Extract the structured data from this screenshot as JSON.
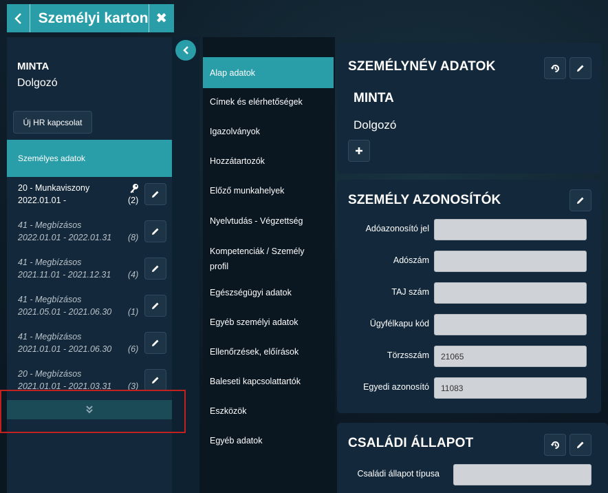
{
  "window": {
    "title": "Személyi karton",
    "back_icon": "chevron-left-icon",
    "close_icon": "close-icon"
  },
  "person": {
    "name": "MINTA",
    "role": "Dolgozó"
  },
  "left": {
    "new_hr_label": "Új HR kapcsolat",
    "personal_tab": "Személyes adatok",
    "relations": [
      {
        "title": "20 - Munkaviszony",
        "dates": "2022.01.01 -",
        "count": "(2)",
        "has_key": true,
        "style": "active"
      },
      {
        "title": "41 - Megbízásos",
        "dates": "2022.01.01 - 2022.01.31",
        "count": "(8)",
        "has_key": false,
        "style": "italic"
      },
      {
        "title": "41 - Megbízásos",
        "dates": "2021.11.01 - 2021.12.31",
        "count": "(4)",
        "has_key": false,
        "style": "italic"
      },
      {
        "title": "41 - Megbízásos",
        "dates": "2021.05.01 - 2021.06.30",
        "count": "(1)",
        "has_key": false,
        "style": "italic"
      },
      {
        "title": "41 - Megbízásos",
        "dates": "2021.01.01 - 2021.06.30",
        "count": "(6)",
        "has_key": false,
        "style": "italic"
      },
      {
        "title": "20 - Megbízásos",
        "dates": "2021.01.01 - 2021.03.31",
        "count": "(3)",
        "has_key": false,
        "style": "italic"
      }
    ],
    "more_icon": "double-chevron-down-icon"
  },
  "nav": {
    "items": [
      "Alap adatok",
      "Címek és elérhetőségek",
      "Igazolványok",
      "Hozzátartozók",
      "Előző munkahelyek",
      "Nyelvtudás - Végzettség",
      "Kompetenciák / Személy profil",
      "Egészségügyi adatok",
      "Egyéb személyi adatok",
      "Ellenőrzések, előírások",
      "Baleseti kapcsolattartók",
      "Eszközök",
      "Egyéb adatok"
    ],
    "active": "Alap adatok"
  },
  "cards": {
    "name_card": {
      "title": "SZEMÉLYNÉV ADATOK",
      "name": "MINTA",
      "role": "Dolgozó"
    },
    "id_card": {
      "title": "SZEMÉLY AZONOSÍTÓK",
      "fields": [
        {
          "label": "Adóazonosító jel",
          "value": ""
        },
        {
          "label": "Adószám",
          "value": ""
        },
        {
          "label": "TAJ szám",
          "value": ""
        },
        {
          "label": "Ügyfélkapu kód",
          "value": ""
        },
        {
          "label": "Törzsszám",
          "value": "21065"
        },
        {
          "label": "Egyedi azonosító",
          "value": "11083"
        }
      ]
    },
    "family_card": {
      "title": "CSALÁDI ÁLLAPOT",
      "fields": [
        {
          "label": "Családi állapot típusa",
          "value": ""
        }
      ]
    }
  },
  "colors": {
    "accent": "#2a9ea8",
    "panel": "#13283a",
    "background": "#0c1a24",
    "input": "#cfd3d7",
    "highlight": "#c32020"
  }
}
